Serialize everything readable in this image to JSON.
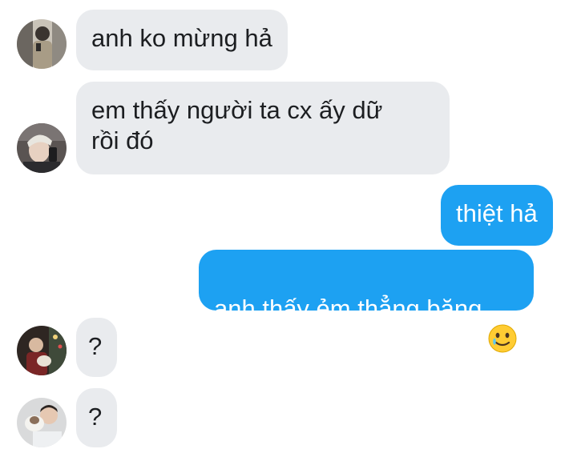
{
  "conversation": {
    "messages": [
      {
        "sender": "contact",
        "text": "anh ko mừng hả"
      },
      {
        "sender": "contact",
        "text": "em thấy người ta cx ấy dữ\nrồi đó"
      },
      {
        "sender": "me",
        "text": "thiệt hả"
      },
      {
        "sender": "me",
        "text": "anh thấy ẻm thẳng băng",
        "emoji": "slightly-smiling-face-with-tear"
      },
      {
        "sender": "contact",
        "text": "?"
      },
      {
        "sender": "contact",
        "text": "?"
      }
    ]
  },
  "colors": {
    "incoming_bubble": "#e9ebee",
    "outgoing_bubble": "#1da1f2",
    "incoming_text": "#1c1e21",
    "outgoing_text": "#ffffff"
  }
}
